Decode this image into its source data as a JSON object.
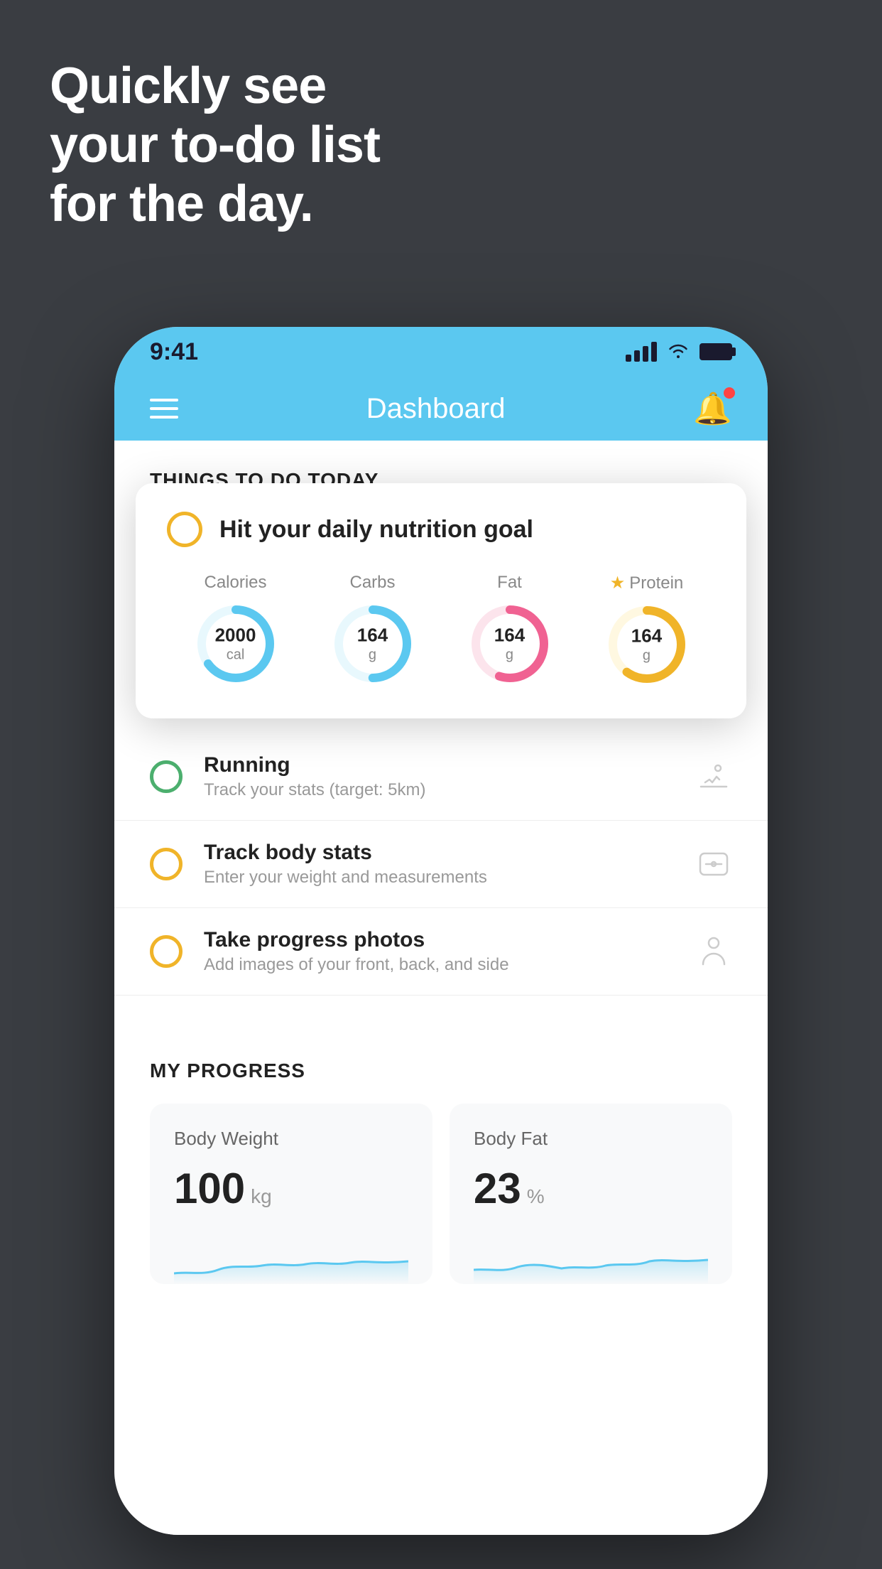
{
  "hero": {
    "title": "Quickly see\nyour to-do list\nfor the day."
  },
  "phone": {
    "statusBar": {
      "time": "9:41"
    },
    "navBar": {
      "title": "Dashboard"
    },
    "sectionHeader": "THINGS TO DO TODAY",
    "floatingCard": {
      "title": "Hit your daily nutrition goal",
      "nutrition": [
        {
          "label": "Calories",
          "value": "2000",
          "unit": "cal",
          "color": "#5bc8f0",
          "trackColor": "#e8f8fd",
          "percent": 65
        },
        {
          "label": "Carbs",
          "value": "164",
          "unit": "g",
          "color": "#5bc8f0",
          "trackColor": "#e8f8fd",
          "percent": 50
        },
        {
          "label": "Fat",
          "value": "164",
          "unit": "g",
          "color": "#f06292",
          "trackColor": "#fce4ec",
          "percent": 55
        },
        {
          "label": "Protein",
          "value": "164",
          "unit": "g",
          "color": "#f0b429",
          "trackColor": "#fff8e1",
          "percent": 60,
          "starred": true
        }
      ]
    },
    "todoItems": [
      {
        "id": "nutrition",
        "title": "Hit your daily nutrition goal",
        "subtitle": "",
        "circleColor": "yellow",
        "icon": "🍎"
      },
      {
        "id": "running",
        "title": "Running",
        "subtitle": "Track your stats (target: 5km)",
        "circleColor": "green",
        "icon": "👟"
      },
      {
        "id": "body-stats",
        "title": "Track body stats",
        "subtitle": "Enter your weight and measurements",
        "circleColor": "yellow",
        "icon": "⚖️"
      },
      {
        "id": "photos",
        "title": "Take progress photos",
        "subtitle": "Add images of your front, back, and side",
        "circleColor": "yellow",
        "icon": "👤"
      }
    ],
    "progress": {
      "title": "MY PROGRESS",
      "cards": [
        {
          "id": "body-weight",
          "title": "Body Weight",
          "value": "100",
          "unit": "kg"
        },
        {
          "id": "body-fat",
          "title": "Body Fat",
          "value": "23",
          "unit": "%"
        }
      ]
    }
  }
}
